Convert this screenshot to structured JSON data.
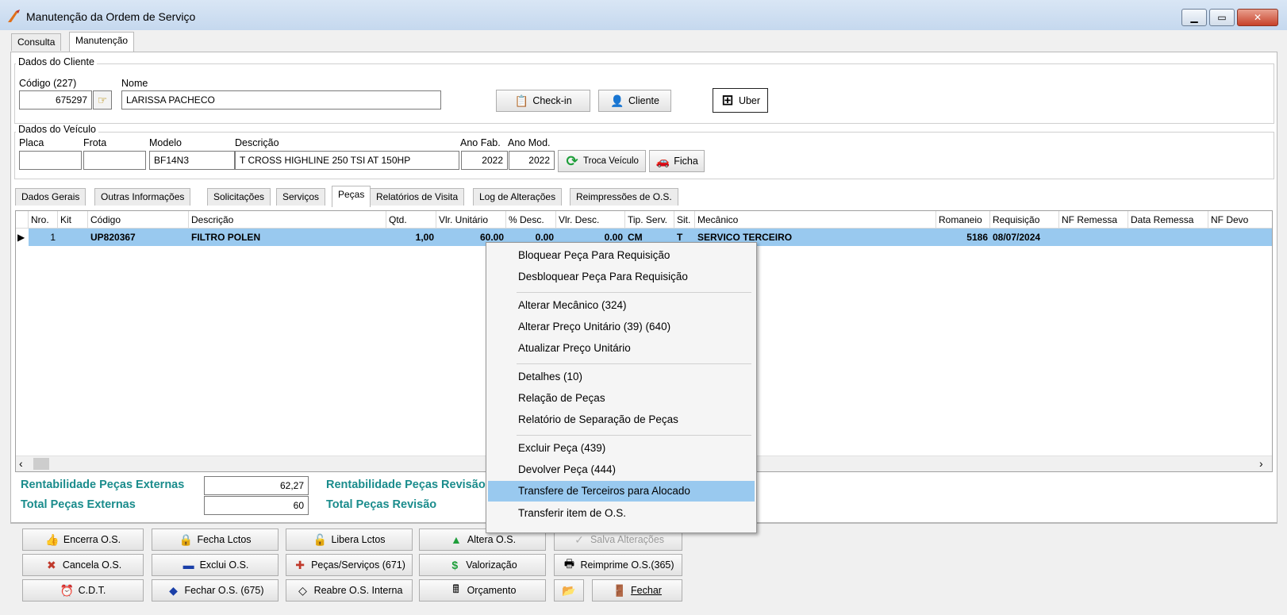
{
  "window": {
    "title": "Manutenção da Ordem de Serviço",
    "controls": {
      "minimize": "▁",
      "maximize": "▭",
      "close": "✕"
    }
  },
  "top_tabs": [
    "Consulta",
    "Manutenção"
  ],
  "cliente": {
    "legend": "Dados do Cliente",
    "codigo_label": "Código (227)",
    "codigo_value": "675297",
    "nome_label": "Nome",
    "nome_value": "LARISSA PACHECO",
    "checkin_label": "Check-in",
    "cliente_label": "Cliente",
    "uber_label": "Uber"
  },
  "veiculo": {
    "legend": "Dados do Veículo",
    "placa_label": "Placa",
    "placa_value": "",
    "frota_label": "Frota",
    "frota_value": "",
    "modelo_label": "Modelo",
    "modelo_value": "BF14N3",
    "descricao_label": "Descrição",
    "descricao_value": "T CROSS HIGHLINE 250 TSI AT 150HP",
    "ano_fab_label": "Ano Fab.",
    "ano_fab_value": "2022",
    "ano_mod_label": "Ano Mod.",
    "ano_mod_value": "2022",
    "troca_label": "Troca Veículo",
    "ficha_label": "Ficha"
  },
  "inner_tabs": [
    "Dados Gerais",
    "Outras Informações",
    "Solicitações",
    "Serviços",
    "Peças",
    "Relatórios de Visita",
    "Log de Alterações",
    "Reimpressões de O.S."
  ],
  "grid": {
    "columns": [
      "Nro.",
      "Kit",
      "Código",
      "Descrição",
      "Qtd.",
      "Vlr. Unitário",
      "% Desc.",
      "Vlr. Desc.",
      "Tip. Serv.",
      "Sit.",
      "Mecânico",
      "Romaneio",
      "Requisição",
      "NF Remessa",
      "Data Remessa",
      "NF Devo"
    ],
    "rows": [
      [
        "1",
        "",
        "UP820367",
        "FILTRO POLEN",
        "1,00",
        "60.00",
        "0.00",
        "0.00",
        "CM",
        "T",
        "SERVICO TERCEIRO",
        "5186",
        "08/07/2024",
        "",
        "",
        ""
      ]
    ]
  },
  "totals": {
    "rent_ext_label": "Rentabilidade Peças Externas",
    "rent_ext_value": "62,27",
    "total_ext_label": "Total Peças Externas",
    "total_ext_value": "60",
    "rent_rev_label": "Rentabilidade Peças Revisão",
    "total_rev_label": "Total Peças Revisão"
  },
  "context_menu": {
    "items": [
      "Bloquear Peça Para Requisição",
      "Desbloquear Peça Para Requisição",
      "Alterar Mecânico (324)",
      "Alterar Preço Unitário (39) (640)",
      "Atualizar Preço Unitário",
      "Detalhes (10)",
      "Relação de Peças",
      "Relatório de Separação de Peças",
      "Excluir Peça (439)",
      "Devolver Peça (444)",
      "Transfere de Terceiros para Alocado",
      "Transferir item de O.S."
    ],
    "highlighted": "Transfere de Terceiros para Alocado"
  },
  "buttons": {
    "encerra": "Encerra O.S.",
    "fecha_lctos": "Fecha Lctos",
    "libera_lctos": "Libera Lctos",
    "altera": "Altera O.S.",
    "salva": "Salva Alterações",
    "cancela": "Cancela O.S.",
    "exclui": "Exclui O.S.",
    "pecas_servicos": "Peças/Serviços (671)",
    "valorizacao": "Valorização",
    "reimprime": "Reimprime O.S.(365)",
    "cdt": "C.D.T.",
    "fechar_os": "Fechar O.S. (675)",
    "reabre": "Reabre O.S. Interna",
    "orcamento": "Orçamento",
    "fechar": "Fechar"
  },
  "colors": {
    "selection": "#99c9ef",
    "teal": "#1a8c8c"
  }
}
